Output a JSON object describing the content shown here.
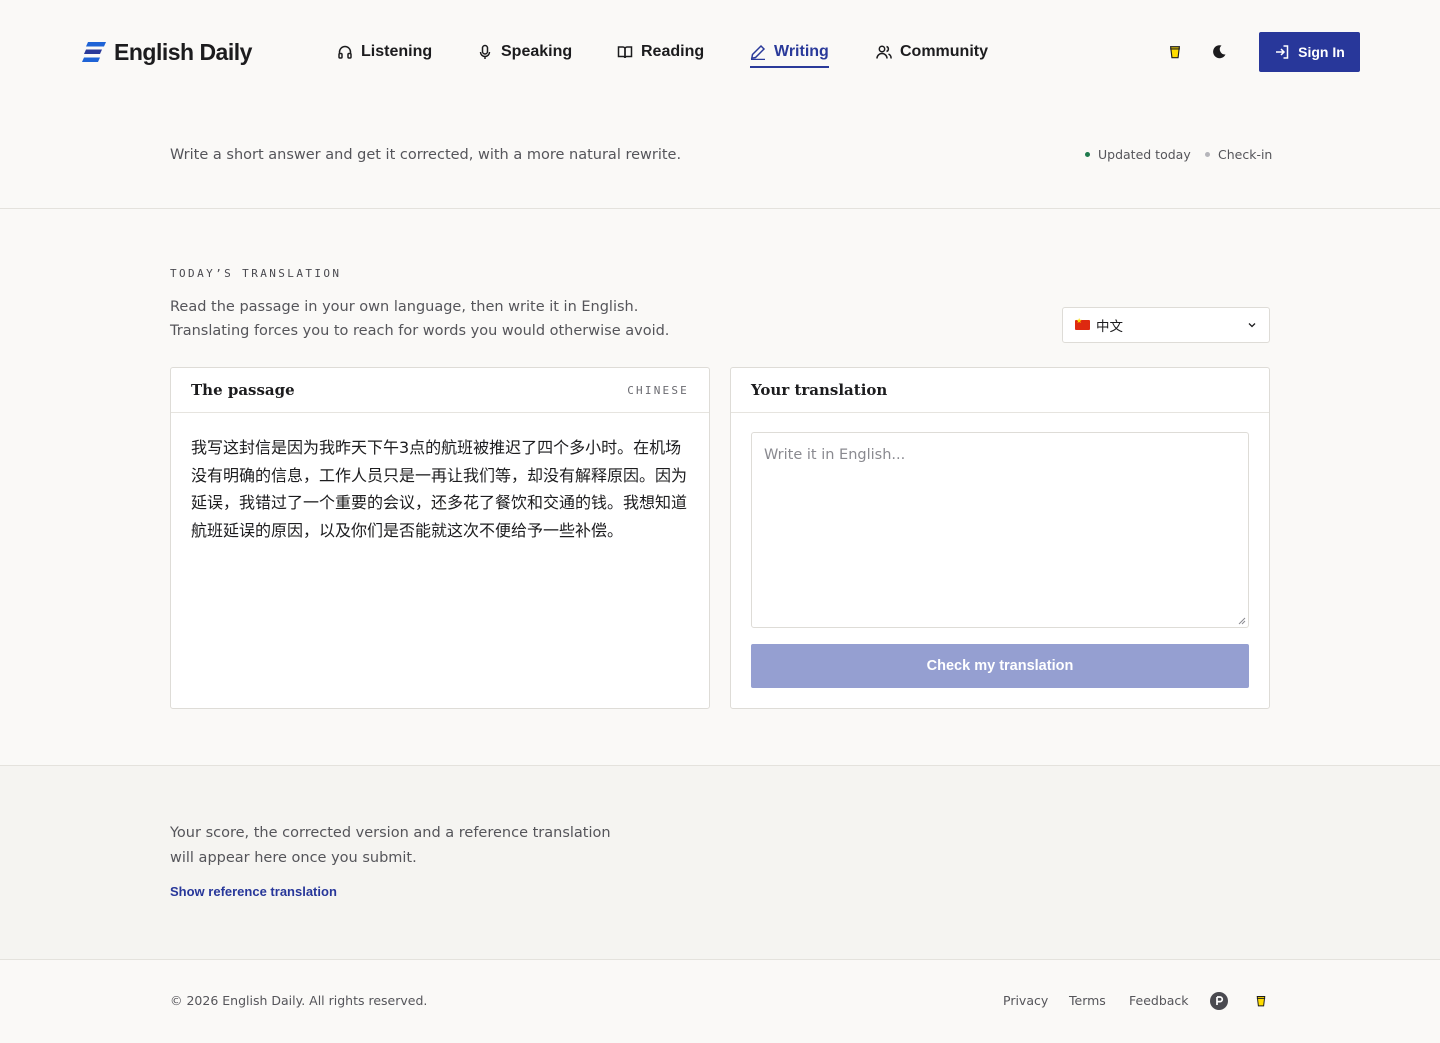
{
  "brand": {
    "name": "English Daily"
  },
  "nav": {
    "items": [
      {
        "label": "Listening",
        "icon": "headphones-icon"
      },
      {
        "label": "Speaking",
        "icon": "microphone-icon"
      },
      {
        "label": "Reading",
        "icon": "book-icon"
      },
      {
        "label": "Writing",
        "icon": "pencil-icon",
        "active": true
      },
      {
        "label": "Community",
        "icon": "users-icon"
      }
    ]
  },
  "header": {
    "sign_in": "Sign In"
  },
  "intro": {
    "text": "Write a short answer and get it corrected, with a more natural rewrite.",
    "status_updated": "Updated today",
    "status_checkin": "Check-in"
  },
  "translation": {
    "eyebrow": "TODAY’S TRANSLATION",
    "desc_line1": "Read the passage in your own language, then write it in English.",
    "desc_line2": "Translating forces you to reach for words you would otherwise avoid.",
    "language": "中文",
    "passage_title": "The passage",
    "passage_tag": "CHINESE",
    "passage_text": "我写这封信是因为我昨天下午3点的航班被推迟了四个多小时。在机场没有明确的信息，工作人员只是一再让我们等，却没有解释原因。因为延误，我错过了一个重要的会议，还多花了餐饮和交通的钱。我想知道航班延误的原因，以及你们是否能就这次不便给予一些补偿。",
    "answer_title": "Your translation",
    "answer_placeholder": "Write it in English...",
    "check_button": "Check my translation"
  },
  "result": {
    "text": "Your score, the corrected version and a reference translation will appear here once you submit.",
    "reference_link": "Show reference translation"
  },
  "footer": {
    "copyright": "© 2026 English Daily. All rights reserved.",
    "privacy": "Privacy",
    "terms": "Terms",
    "feedback": "Feedback"
  },
  "colors": {
    "accent": "#28379a",
    "accent_disabled": "#959fd1",
    "status_green": "#1f7a4d",
    "status_gray": "#b5b5ba",
    "background": "#faf9f7"
  }
}
